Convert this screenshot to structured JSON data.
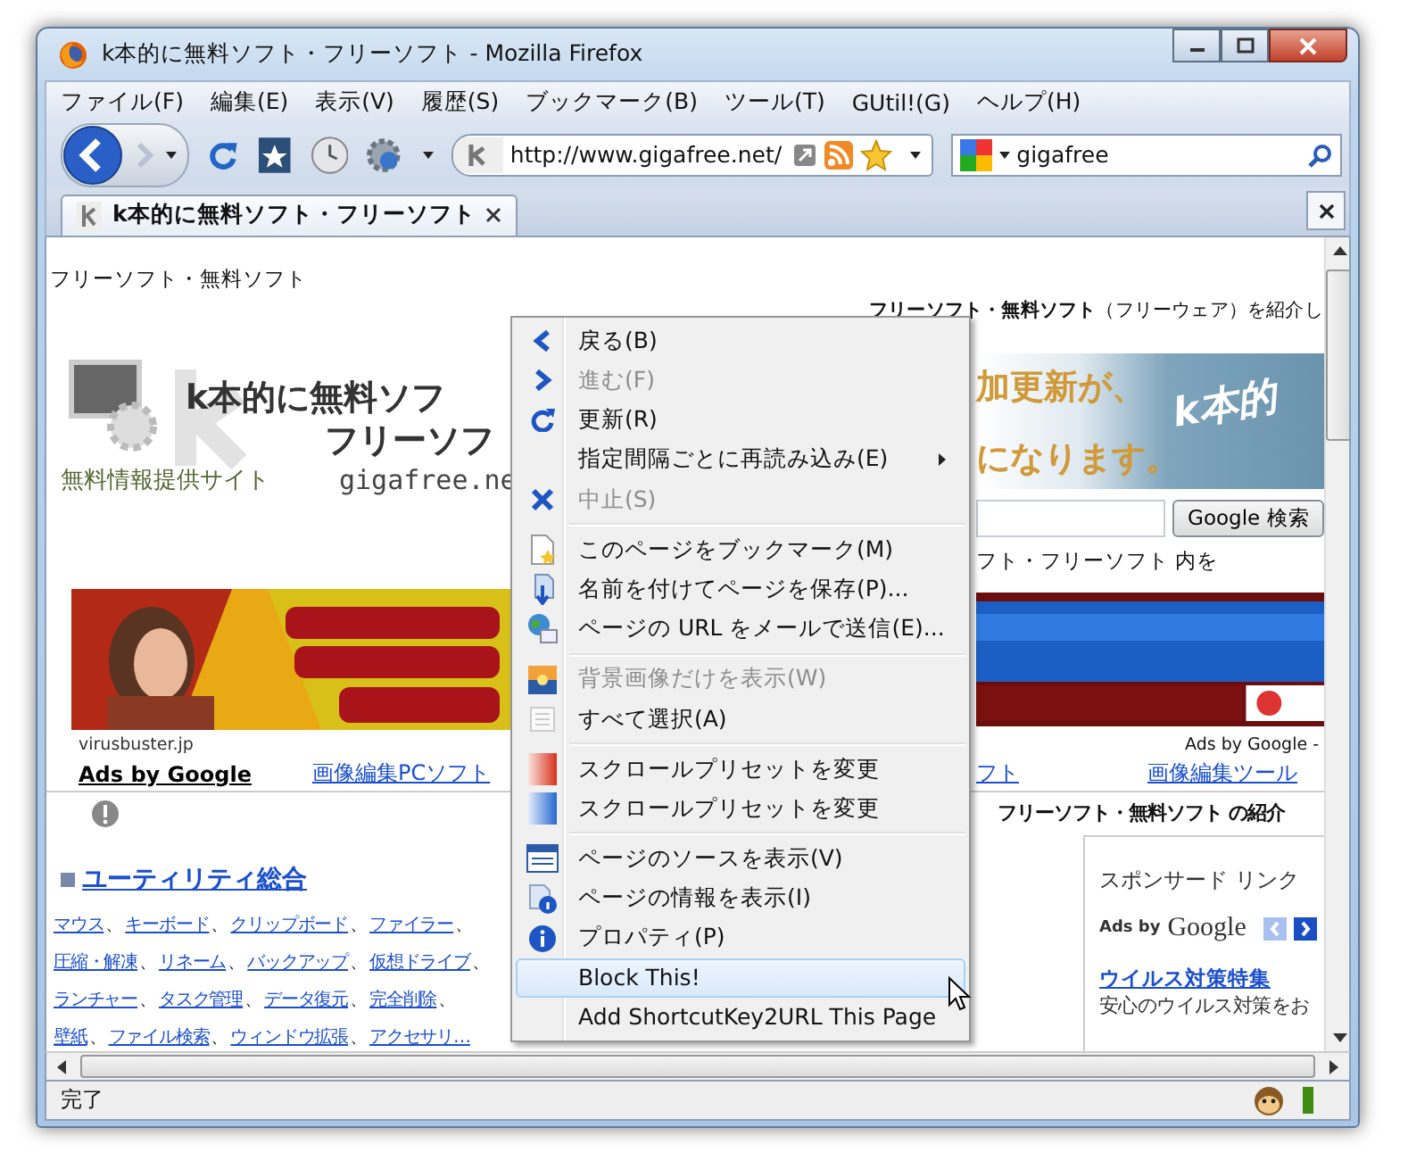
{
  "window": {
    "title": "k本的に無料ソフト・フリーソフト - Mozilla Firefox"
  },
  "menu_bar": [
    "ファイル(F)",
    "編集(E)",
    "表示(V)",
    "履歴(S)",
    "ブックマーク(B)",
    "ツール(T)",
    "GUtil!(G)",
    "ヘルプ(H)"
  ],
  "toolbar": {
    "url": "http://www.gigafree.net/",
    "search": "gigafree"
  },
  "tabs": [
    {
      "label": "k本的に無料ソフト・フリーソフト",
      "selected": true
    }
  ],
  "page": {
    "site_heading": "フリーソフト・無料ソフト",
    "intro": "**フリーソフト・無料ソフト**（フリーウェア）を紹介し",
    "logo": {
      "title_line1": "k本的に無料ソフ",
      "title_line2": "フリーソフ",
      "domain": "gigafree.ne",
      "tagline": "無料情報提供サイト"
    },
    "banner": {
      "line1": "加更新が、",
      "line2": "になります。",
      "mark": "k本的"
    },
    "search_button": "Google 検索",
    "search_scope": "フト・フリーソフト 内を",
    "ad_source": "virusbuster.jp",
    "ad_credit": "Ads by Google -",
    "links_left": [
      "Ads by Google",
      "画像編集PCソフト"
    ],
    "links_right": [
      "フト",
      "画像編集ツール"
    ],
    "section_title": "フリーソフト・無料ソフト の紹介",
    "category": {
      "title": "ユーティリティ総合",
      "separator": "、",
      "rows": [
        [
          "マウス",
          "キーボード",
          "クリップボード",
          "ファイラー"
        ],
        [
          "圧縮・解凍",
          "リネーム",
          "バックアップ",
          "仮想ドライブ"
        ],
        [
          "ランチャー",
          "タスク管理",
          "データ復元",
          "完全削除"
        ],
        [
          "壁紙",
          "ファイル検索",
          "ウィンドウ拡張",
          "アクセサリ…"
        ]
      ]
    },
    "sponsored": {
      "heading": "スポンサード リンク",
      "ads_by": "Ads by",
      "google": "Google",
      "link": "ウイルス対策特集",
      "text": "安心のウイルス対策をお"
    }
  },
  "context_menu": [
    [
      {
        "label": "戻る(B)",
        "disabled": false,
        "submenu": false,
        "selected": false
      },
      {
        "label": "進む(F)",
        "disabled": true,
        "submenu": false,
        "selected": false
      },
      {
        "label": "更新(R)",
        "disabled": false,
        "submenu": false,
        "selected": false
      },
      {
        "label": "指定間隔ごとに再読み込み(E)",
        "disabled": false,
        "submenu": true,
        "selected": false
      },
      {
        "label": "中止(S)",
        "disabled": true,
        "submenu": false,
        "selected": false
      }
    ],
    [
      {
        "label": "このページをブックマーク(M)",
        "disabled": false,
        "submenu": false,
        "selected": false
      },
      {
        "label": "名前を付けてページを保存(P)...",
        "disabled": false,
        "submenu": false,
        "selected": false
      },
      {
        "label": "ページの URL をメールで送信(E)...",
        "disabled": false,
        "submenu": false,
        "selected": false
      }
    ],
    [
      {
        "label": "背景画像だけを表示(W)",
        "disabled": true,
        "submenu": false,
        "selected": false
      },
      {
        "label": "すべて選択(A)",
        "disabled": false,
        "submenu": false,
        "selected": false
      }
    ],
    [
      {
        "label": "スクロールプリセットを変更",
        "disabled": false,
        "submenu": false,
        "selected": false
      },
      {
        "label": "スクロールプリセットを変更",
        "disabled": false,
        "submenu": false,
        "selected": false
      }
    ],
    [
      {
        "label": "ページのソースを表示(V)",
        "disabled": false,
        "submenu": false,
        "selected": false
      },
      {
        "label": "ページの情報を表示(I)",
        "disabled": false,
        "submenu": false,
        "selected": false
      },
      {
        "label": "プロパティ(P)",
        "disabled": false,
        "submenu": false,
        "selected": false
      },
      {
        "label": "Block This!",
        "disabled": false,
        "submenu": false,
        "selected": true
      },
      {
        "label": "Add ShortcutKey2URL This Page",
        "disabled": false,
        "submenu": false,
        "selected": false
      }
    ]
  ],
  "status_bar": {
    "text": "完了"
  }
}
